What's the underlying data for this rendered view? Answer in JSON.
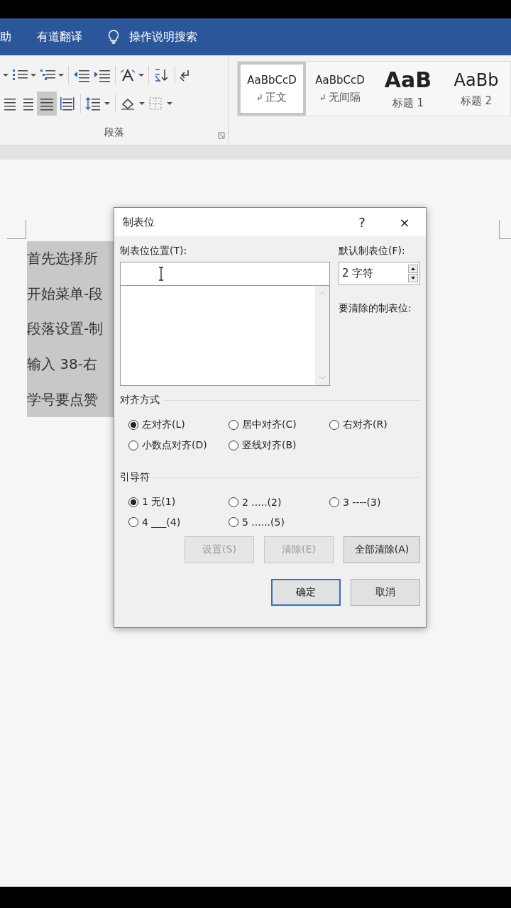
{
  "ribbon_tabs": [
    {
      "kind": "tab",
      "label": "助"
    },
    {
      "kind": "tab",
      "label": "有道翻译"
    },
    {
      "kind": "search",
      "label": "操作说明搜索"
    }
  ],
  "toolbar_rows": [
    [
      {
        "kind": "caret",
        "selected": false
      },
      {
        "kind": "numbering",
        "selected": false
      },
      {
        "kind": "multilevel",
        "selected": false
      },
      {
        "kind": "sep"
      },
      {
        "kind": "outdent",
        "selected": false
      },
      {
        "kind": "indent",
        "selected": false
      },
      {
        "kind": "sep"
      },
      {
        "kind": "asian",
        "selected": false
      },
      {
        "kind": "sep"
      },
      {
        "kind": "sort",
        "selected": false
      },
      {
        "kind": "sep"
      },
      {
        "kind": "marks",
        "selected": false
      }
    ],
    [
      {
        "kind": "center",
        "selected": false
      },
      {
        "kind": "right",
        "selected": false
      },
      {
        "kind": "justify",
        "selected": true
      },
      {
        "kind": "distribute",
        "selected": false
      },
      {
        "kind": "sep"
      },
      {
        "kind": "spacing",
        "selected": false
      },
      {
        "kind": "sep"
      },
      {
        "kind": "shading",
        "selected": false
      },
      {
        "kind": "borders",
        "selected": false
      }
    ]
  ],
  "paragraph_group": {
    "label": "段落"
  },
  "styles": [
    {
      "kind": "body",
      "preview": "AaBbCcD",
      "label": "正文",
      "selected": true
    },
    {
      "kind": "body",
      "preview": "AaBbCcD",
      "label": "无间隔",
      "selected": false
    },
    {
      "kind": "heading1",
      "preview": "AaB",
      "label": "标题 1",
      "selected": false
    },
    {
      "kind": "heading2",
      "preview": "AaBb",
      "label": "标题 2",
      "selected": false
    }
  ],
  "document": {
    "lines": [
      "首先选择所",
      "开始菜单-段",
      "段落设置-制",
      "输入 38-右",
      "学号要点赞"
    ]
  },
  "dialog": {
    "title": "制表位",
    "help": "?",
    "close": "×",
    "position_label": "制表位位置(T):",
    "default_label": "默认制表位(F):",
    "default_value": "2 字符",
    "clear_label": "要清除的制表位:",
    "alignment": {
      "title": "对齐方式",
      "options": [
        {
          "label": "左对齐(L)",
          "selected": true
        },
        {
          "label": "居中对齐(C)",
          "selected": false
        },
        {
          "label": "右对齐(R)",
          "selected": false
        },
        {
          "label": "小数点对齐(D)",
          "selected": false
        },
        {
          "label": "竖线对齐(B)",
          "selected": false
        }
      ]
    },
    "leader": {
      "title": "引导符",
      "options": [
        {
          "label": "1 无(1)",
          "selected": true
        },
        {
          "label": "2 .....(2)",
          "selected": false
        },
        {
          "label": "3 ----(3)",
          "selected": false
        },
        {
          "label": "4 ___(4)",
          "selected": false
        },
        {
          "label": "5 ......(5)",
          "selected": false
        }
      ]
    },
    "action_buttons": [
      {
        "label": "设置(S)",
        "disabled": true
      },
      {
        "label": "清除(E)",
        "disabled": true
      },
      {
        "label": "全部清除(A)",
        "disabled": false
      }
    ],
    "footer_buttons": [
      {
        "label": "确定",
        "default": true
      },
      {
        "label": "取消",
        "default": false
      }
    ]
  }
}
